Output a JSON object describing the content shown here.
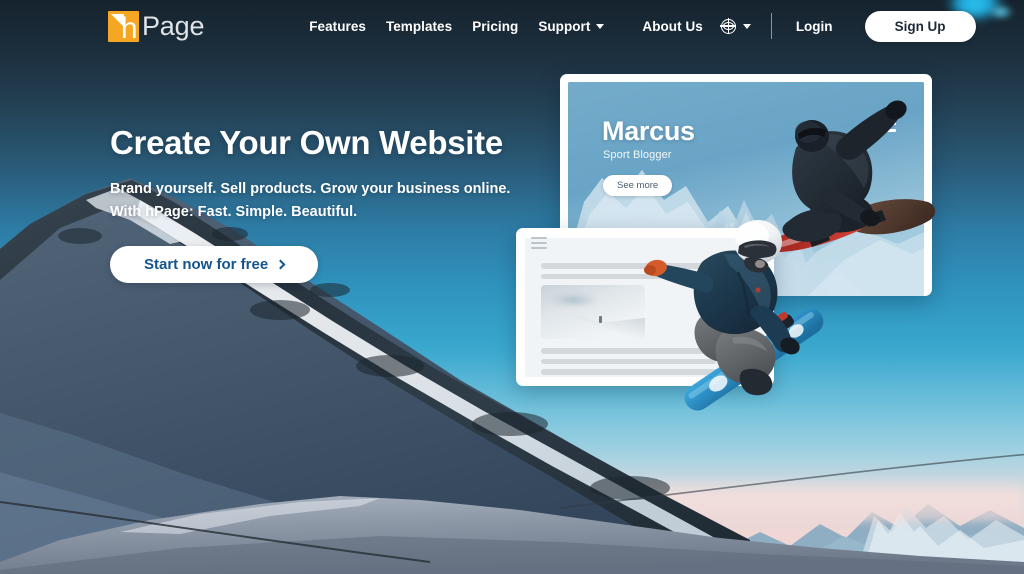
{
  "brand": {
    "logo_mark": "hpage-logo-icon",
    "logo_letter": "h",
    "logo_text": "Page"
  },
  "nav": {
    "links": [
      {
        "label": "Features",
        "has_caret": false
      },
      {
        "label": "Templates",
        "has_caret": false
      },
      {
        "label": "Pricing",
        "has_caret": false
      },
      {
        "label": "Support",
        "has_caret": true
      },
      {
        "label": "About Us",
        "has_caret": false
      }
    ],
    "language_icon": "globe-icon",
    "language_caret": "chevron-down-icon",
    "login_label": "Login",
    "signup_label": "Sign Up"
  },
  "hero": {
    "heading": "Create Your Own Website",
    "line1": "Brand yourself. Sell products. Grow your business online.",
    "line2": "With hPage: Fast. Simple. Beautiful.",
    "cta_label": "Start now for free",
    "cta_icon": "chevron-right-icon"
  },
  "mockup_big": {
    "title": "Marcus",
    "subtitle": "Sport Blogger",
    "button_label": "See more",
    "menu_icon": "hamburger-menu-icon"
  },
  "mockup_small": {
    "menu_icon": "hamburger-menu-icon",
    "image_alt": "snow-landscape-thumbnail"
  },
  "colors": {
    "brand_orange": "#f5a623",
    "cta_text": "#16558c",
    "nav_text": "#ffffff",
    "sky_top": "#16232e",
    "sky_mid": "#2f93be",
    "sky_bottom": "#e8cfd2",
    "card_surface": "#ffffff"
  }
}
